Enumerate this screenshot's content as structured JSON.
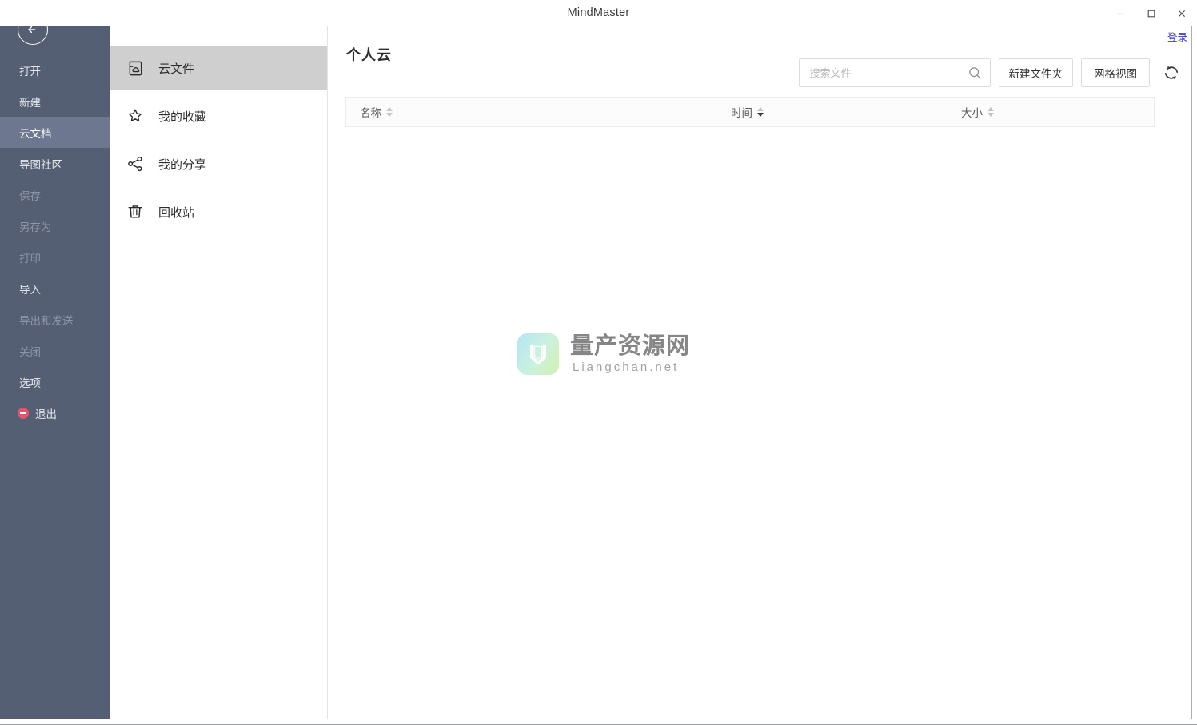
{
  "window": {
    "title": "MindMaster",
    "controls": [
      {
        "name": "minimize-button",
        "glyph": "minimize"
      },
      {
        "name": "maximize-button",
        "glyph": "maximize"
      },
      {
        "name": "close-button",
        "glyph": "close"
      }
    ],
    "login_label": "登录"
  },
  "sidebar": {
    "back_icon": "back-arrow-icon",
    "items": [
      {
        "label": "打开",
        "state": "normal"
      },
      {
        "label": "新建",
        "state": "normal"
      },
      {
        "label": "云文档",
        "state": "active"
      },
      {
        "label": "导图社区",
        "state": "normal"
      },
      {
        "label": "保存",
        "state": "disabled"
      },
      {
        "label": "另存为",
        "state": "disabled"
      },
      {
        "label": "打印",
        "state": "disabled"
      },
      {
        "label": "导入",
        "state": "normal"
      },
      {
        "label": "导出和发送",
        "state": "disabled"
      },
      {
        "label": "关闭",
        "state": "disabled"
      },
      {
        "label": "选项",
        "state": "normal"
      },
      {
        "label": "退出",
        "state": "exit"
      }
    ]
  },
  "nav": {
    "items": [
      {
        "label": "云文件",
        "icon": "cloud-document-icon",
        "selected": true
      },
      {
        "label": "我的收藏",
        "icon": "star-icon",
        "selected": false
      },
      {
        "label": "我的分享",
        "icon": "share-icon",
        "selected": false
      },
      {
        "label": "回收站",
        "icon": "trash-icon",
        "selected": false
      }
    ]
  },
  "main": {
    "title": "个人云",
    "search": {
      "value": "",
      "placeholder": "搜索文件",
      "icon": "search-icon"
    },
    "buttons": {
      "new_folder": "新建文件夹",
      "grid_view": "网格视图",
      "refresh_icon": "refresh-icon"
    },
    "table": {
      "columns": [
        {
          "label": "名称",
          "sort": "none"
        },
        {
          "label": "时间",
          "sort": "desc"
        },
        {
          "label": "大小",
          "sort": "none"
        }
      ],
      "rows": []
    }
  },
  "watermark": {
    "cn": "量产资源网",
    "en": "Liangchan.net",
    "mark_icon": "liangchan-logo-icon"
  },
  "colors": {
    "sidebar_bg": "#555f73",
    "sidebar_active_bg": "#6d7890",
    "nav_selected_bg": "#cfcfcf",
    "login_link": "#3b3bc8",
    "exit_icon": "#e0576b"
  }
}
